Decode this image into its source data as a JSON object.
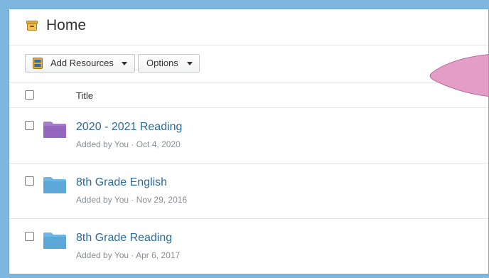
{
  "header": {
    "title": "Home",
    "icon": "home-drawer-icon"
  },
  "toolbar": {
    "add_resources_label": "Add Resources",
    "options_label": "Options"
  },
  "table": {
    "columns": {
      "title": "Title"
    },
    "rows": [
      {
        "name": "2020 - 2021 Reading",
        "meta": "Added by You · Oct 4, 2020",
        "folder_color": "#a47cc9",
        "folder_icon": "folder-icon"
      },
      {
        "name": "8th Grade English",
        "meta": "Added by You · Nov 29, 2016",
        "folder_color": "#6cb7e3",
        "folder_icon": "folder-icon"
      },
      {
        "name": "8th Grade Reading",
        "meta": "Added by You · Apr 6, 2017",
        "folder_color": "#6cb7e3",
        "folder_icon": "folder-icon"
      }
    ]
  },
  "colors": {
    "frame": "#7db7df",
    "link": "#2b6a9b",
    "accent_yellow": "#e0a93a",
    "blob_pink": "#e39ec8"
  }
}
